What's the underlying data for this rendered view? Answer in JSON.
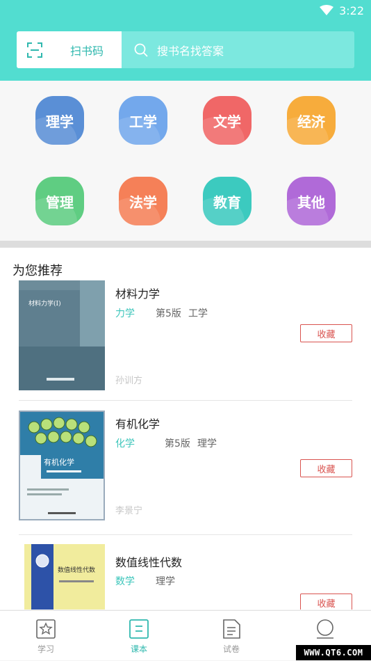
{
  "status": {
    "time": "3:22"
  },
  "header": {
    "scan_label": "扫书码",
    "search_placeholder": "搜书名找答案"
  },
  "categories": [
    {
      "label": "理学",
      "color": "#5a8fd6"
    },
    {
      "label": "工学",
      "color": "#73a8ec"
    },
    {
      "label": "文学",
      "color": "#f06767"
    },
    {
      "label": "经济",
      "color": "#f7ac3c"
    },
    {
      "label": "管理",
      "color": "#5fcd82"
    },
    {
      "label": "法学",
      "color": "#f58058"
    },
    {
      "label": "教育",
      "color": "#3ccabf"
    },
    {
      "label": "其他",
      "color": "#b06ad8"
    }
  ],
  "recommend": {
    "title": "为您推荐",
    "collect_label": "收藏",
    "books": [
      {
        "title": "材料力学",
        "subject": "力学",
        "edition": "第5版",
        "field": "工学",
        "author": "孙训方",
        "cover_text": "材料力学(Ⅰ)"
      },
      {
        "title": "有机化学",
        "subject": "化学",
        "edition": "第5版",
        "field": "理学",
        "author": "李景宁",
        "cover_text": "有机化学"
      },
      {
        "title": "数值线性代数",
        "subject": "数学",
        "edition": "",
        "field": "理学",
        "author": "",
        "cover_text": "数值线性代数"
      }
    ]
  },
  "tabs": [
    {
      "label": "学习",
      "icon": "star-icon"
    },
    {
      "label": "课本",
      "icon": "book-icon"
    },
    {
      "label": "试卷",
      "icon": "document-icon"
    },
    {
      "label": "",
      "icon": "profile-icon"
    }
  ],
  "watermark": "WWW.QT6.COM"
}
